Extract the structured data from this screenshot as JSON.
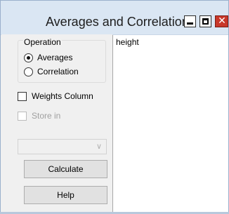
{
  "window": {
    "title": "Averages and Correlation"
  },
  "operation": {
    "legend": "Operation",
    "options": [
      {
        "label": "Averages",
        "selected": true
      },
      {
        "label": "Correlation",
        "selected": false
      }
    ]
  },
  "weights_column": {
    "label": "Weights Column",
    "checked": false,
    "enabled": true
  },
  "store_in": {
    "label": "Store in",
    "checked": false,
    "enabled": false
  },
  "column_select": {
    "value": ""
  },
  "buttons": {
    "calculate": "Calculate",
    "help": "Help"
  },
  "output": {
    "text": "height"
  },
  "icons": {
    "minimize": "minimize-icon",
    "maximize": "maximize-icon",
    "close": "close-icon",
    "dropdown": "chevron-down-icon"
  },
  "colors": {
    "titlebar": "#dae6f3",
    "close_button": "#c8372a",
    "panel_background": "#f0f0f0"
  }
}
